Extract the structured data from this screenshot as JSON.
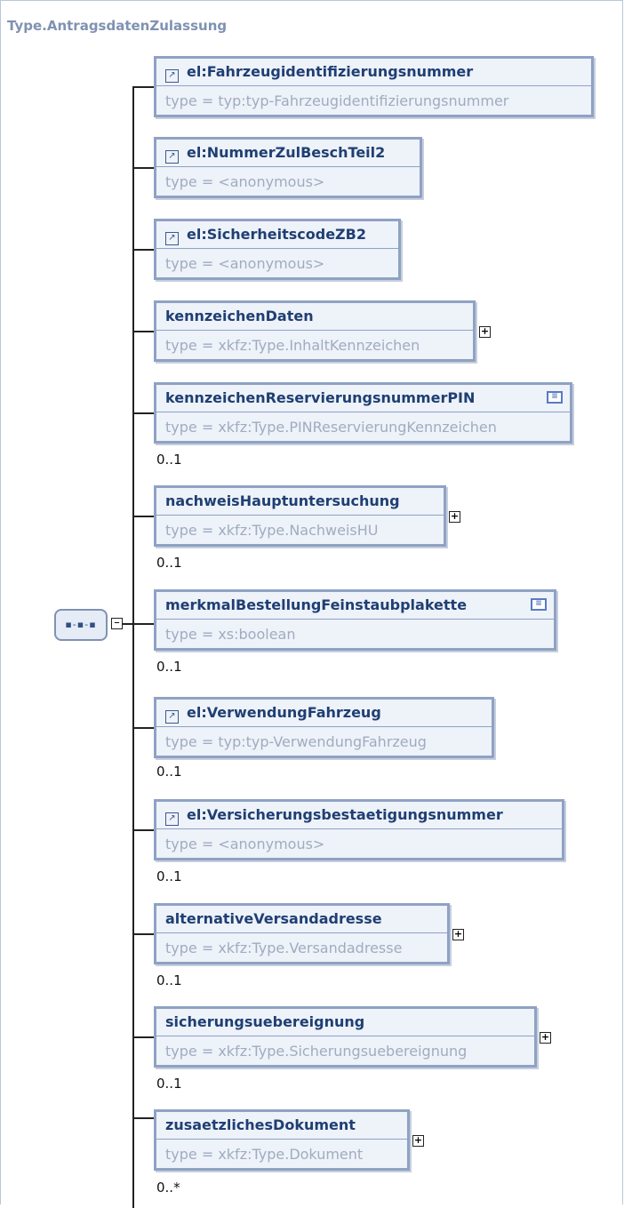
{
  "title": "Type.AntragsdatenZulassung",
  "compositor": {
    "icon": "sequence-icon",
    "glyph": "▪-▪-▪",
    "toggle": "–"
  },
  "elements": [
    {
      "name": "el:Fahrzeugidentifizierungsnummer",
      "type": "type = typ:typ-Fahrzeugidentifizierungsnummer",
      "ref": true
    },
    {
      "name": "el:NummerZulBeschTeil2",
      "type": "type = <anonymous>",
      "ref": true
    },
    {
      "name": "el:SicherheitscodeZB2",
      "type": "type = <anonymous>",
      "ref": true
    },
    {
      "name": "kennzeichenDaten",
      "type": "type = xkfz:Type.InhaltKennzeichen",
      "expand": true
    },
    {
      "name": "kennzeichenReservierungsnummerPIN",
      "type": "type = xkfz:Type.PINReservierungKennzeichen",
      "doc": true,
      "occurs": "0..1"
    },
    {
      "name": "nachweisHauptuntersuchung",
      "type": "type = xkfz:Type.NachweisHU",
      "expand": true,
      "occurs": "0..1"
    },
    {
      "name": "merkmalBestellungFeinstaubplakette",
      "type": "type = xs:boolean",
      "doc": true,
      "occurs": "0..1"
    },
    {
      "name": "el:VerwendungFahrzeug",
      "type": "type = typ:typ-VerwendungFahrzeug",
      "ref": true,
      "occurs": "0..1"
    },
    {
      "name": "el:Versicherungsbestaetigungsnummer",
      "type": "type = <anonymous>",
      "ref": true,
      "occurs": "0..1"
    },
    {
      "name": "alternativeVersandadresse",
      "type": "type = xkfz:Type.Versandadresse",
      "expand": true,
      "occurs": "0..1"
    },
    {
      "name": "sicherungsuebereignung",
      "type": "type = xkfz:Type.Sicherungsuebereignung",
      "expand": true,
      "occurs": "0..1"
    },
    {
      "name": "zusaetzlichesDokument",
      "type": "type = xkfz:Type.Dokument",
      "expand": true,
      "occurs": "0..*"
    }
  ],
  "colors": {
    "border": "#8ea2c4",
    "fill": "#eef2f9",
    "name_text": "#1f3f73",
    "type_text": "#a0acc0",
    "title": "#7f92b3"
  }
}
